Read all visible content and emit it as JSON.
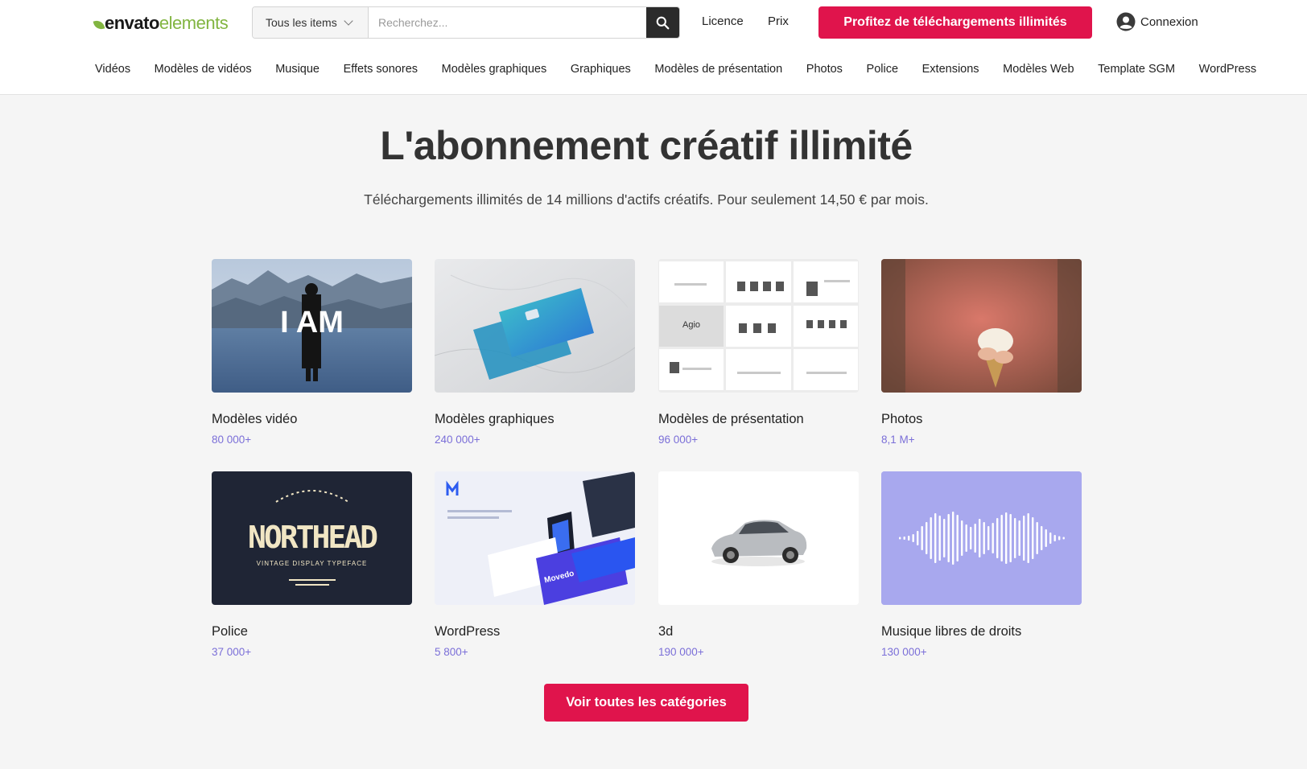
{
  "header": {
    "logo_part1": "envato",
    "logo_part2": "elements",
    "search_category": "Tous les items",
    "search_placeholder": "Recherchez...",
    "links": [
      "Licence",
      "Prix"
    ],
    "cta_label": "Profitez de téléchargements illimités",
    "login_label": "Connexion"
  },
  "nav": {
    "items": [
      "Vidéos",
      "Modèles de vidéos",
      "Musique",
      "Effets sonores",
      "Modèles graphiques",
      "Graphiques",
      "Modèles de présentation",
      "Photos",
      "Police",
      "Extensions",
      "Modèles Web",
      "Template SGM",
      "WordPress"
    ]
  },
  "hero": {
    "title": "L'abonnement créatif illimité",
    "subtitle": "Téléchargements illimités de 14 millions d'actifs créatifs. Pour seulement 14,50 € par mois."
  },
  "categories": [
    {
      "title": "Modèles vidéo",
      "count": "80 000+",
      "image_text": "I AM"
    },
    {
      "title": "Modèles graphiques",
      "count": "240 000+"
    },
    {
      "title": "Modèles de présentation",
      "count": "96 000+",
      "image_text": "Agio"
    },
    {
      "title": "Photos",
      "count": "8,1 M+"
    },
    {
      "title": "Police",
      "count": "37 000+",
      "image_text": "NORTHEAD",
      "image_subtext": "VINTAGE DISPLAY TYPEFACE"
    },
    {
      "title": "WordPress",
      "count": "5 800+",
      "image_text": "Movedo"
    },
    {
      "title": "3d",
      "count": "190 000+"
    },
    {
      "title": "Musique libres de droits",
      "count": "130 000+"
    }
  ],
  "see_all_label": "Voir toutes les catégories",
  "colors": {
    "accent": "#e0144c",
    "brand_green": "#82b541",
    "count_purple": "#7b6fd8",
    "music_tile": "#a8a8ee"
  }
}
